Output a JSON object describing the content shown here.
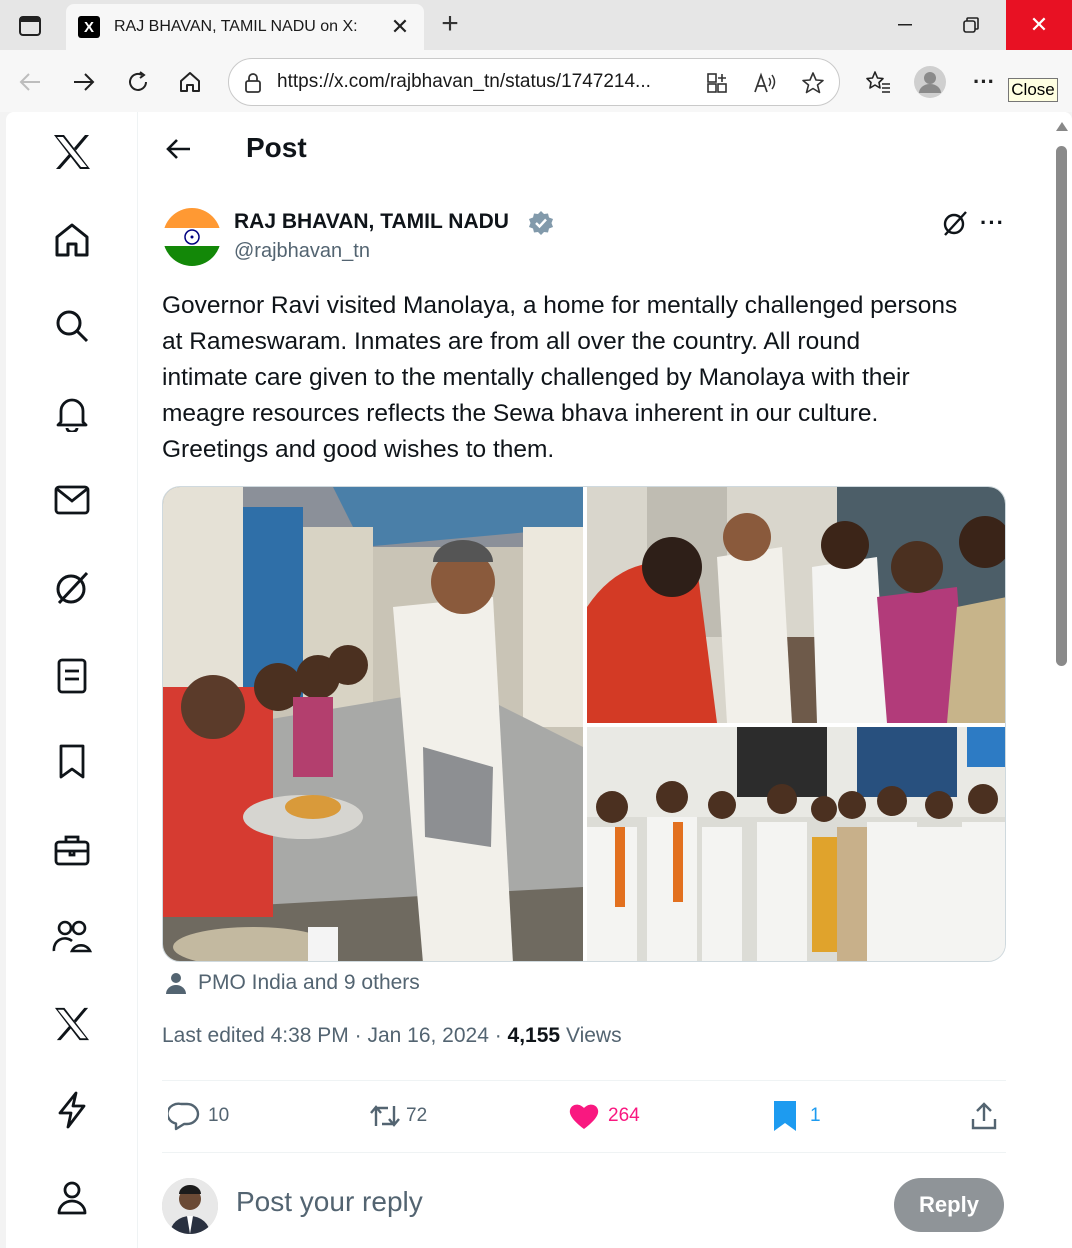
{
  "browser": {
    "tab_title": "RAJ BHAVAN, TAMIL NADU on X:",
    "favicon": "X",
    "url": "https://x.com/rajbhavan_tn/status/1747214...",
    "close_tooltip": "Close",
    "close_glyph": "✕"
  },
  "page": {
    "header_title": "Post",
    "author": {
      "name": "RAJ BHAVAN, TAMIL NADU",
      "handle": "@rajbhavan_tn"
    },
    "post_lines": [
      "Governor Ravi visited Manolaya, a home for mentally challenged persons",
      "at Rameswaram. Inmates are from all over the country.  All round",
      "intimate care given to the mentally challenged by Manolaya with their",
      "meagre resources reflects the Sewa bhava inherent in our culture.",
      "Greetings and good wishes to them."
    ],
    "tagged": "PMO India and 9 others",
    "meta": {
      "edited": "Last edited 4:38 PM · Jan 16, 2024 · ",
      "views_count": "4,155",
      "views_label": " Views"
    },
    "actions": {
      "replies": "10",
      "reposts": "72",
      "likes": "264",
      "bookmarks": "1"
    },
    "reply": {
      "placeholder": "Post your reply",
      "button": "Reply"
    }
  },
  "colors": {
    "like": "#f91880",
    "bookmark": "#1d9bf0",
    "secondary_text": "#536471",
    "verified": "#829aab"
  }
}
